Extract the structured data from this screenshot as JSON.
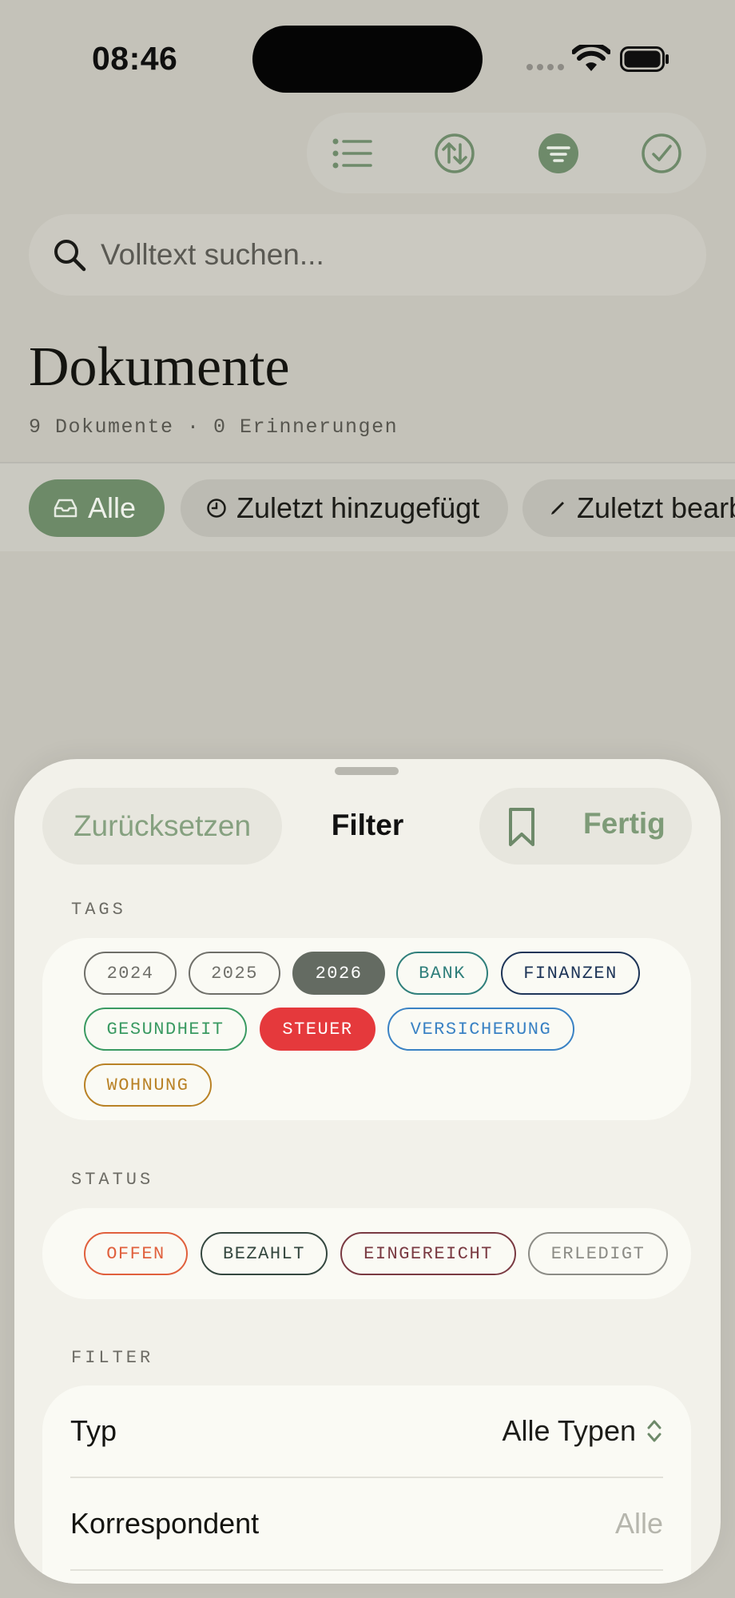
{
  "status_bar": {
    "time": "08:46"
  },
  "search": {
    "placeholder": "Volltext suchen..."
  },
  "header": {
    "title": "Dokumente",
    "subtitle": "9 Dokumente · 0 Erinnerungen"
  },
  "quick_filters": [
    {
      "label": "Alle",
      "icon": "inbox-icon",
      "active": true
    },
    {
      "label": "Zuletzt hinzugefügt",
      "icon": "clock-icon",
      "active": false
    },
    {
      "label": "Zuletzt bearb",
      "icon": "pencil-icon",
      "active": false
    }
  ],
  "sheet": {
    "reset_label": "Zurücksetzen",
    "title": "Filter",
    "done_label": "Fertig",
    "tags_label": "TAGS",
    "status_label": "STATUS",
    "filter_label": "FILTER",
    "tags": [
      {
        "label": "2024",
        "color": "#6f6f69",
        "selected": false
      },
      {
        "label": "2025",
        "color": "#6f6f69",
        "selected": false
      },
      {
        "label": "2026",
        "color": "#646b62",
        "selected": true
      },
      {
        "label": "BANK",
        "color": "#2f7f7b",
        "selected": false
      },
      {
        "label": "FINANZEN",
        "color": "#1e3558",
        "selected": false
      },
      {
        "label": "GESUNDHEIT",
        "color": "#3a9a62",
        "selected": false
      },
      {
        "label": "STEUER",
        "color": "#e5393c",
        "selected": true
      },
      {
        "label": "VERSICHERUNG",
        "color": "#3a82c4",
        "selected": false
      },
      {
        "label": "WOHNUNG",
        "color": "#b98226",
        "selected": false
      }
    ],
    "statuses": [
      {
        "label": "OFFEN",
        "color": "#e0603d"
      },
      {
        "label": "BEZAHLT",
        "color": "#34473f"
      },
      {
        "label": "EINGEREICHT",
        "color": "#7a3a42"
      },
      {
        "label": "ERLEDIGT",
        "color": "#8c8c86"
      }
    ],
    "rows": [
      {
        "label": "Typ",
        "value": "Alle Typen"
      },
      {
        "label": "Korrespondent",
        "value": "Alle"
      }
    ]
  },
  "colors": {
    "accent": "#6d8a68",
    "background": "#c4c2b9",
    "sheet": "#f2f1ea"
  }
}
